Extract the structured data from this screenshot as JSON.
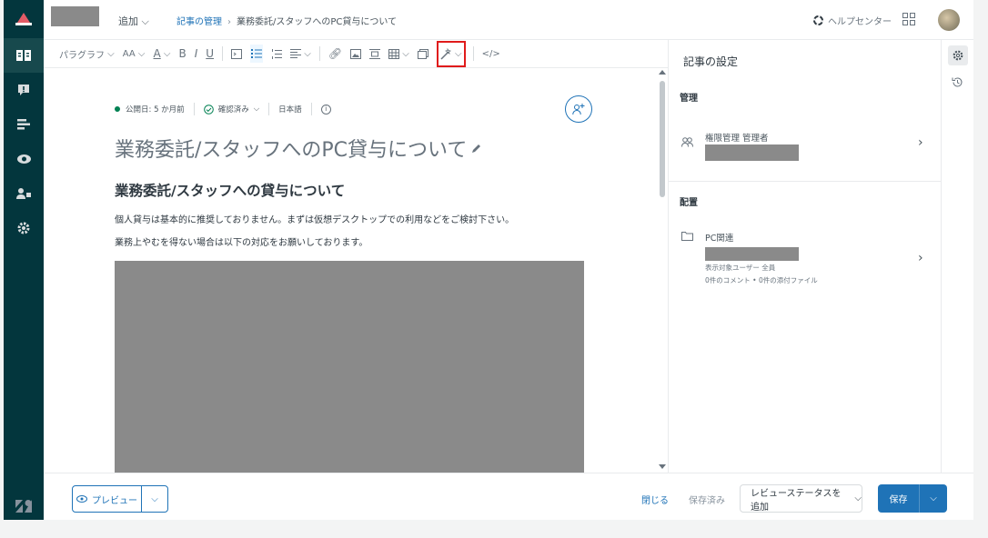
{
  "topbar": {
    "add_label": "追加",
    "breadcrumb": {
      "parent": "記事の管理",
      "current": "業務委託/スタッフへのPC貸与について"
    },
    "help_label": "ヘルプセンター"
  },
  "toolbar": {
    "paragraph_label": "パラグラフ",
    "font_size_label": "AA",
    "bold": "B",
    "italic": "I",
    "underline": "U"
  },
  "article": {
    "status_published": "公開日: 5 か月前",
    "status_verified": "確認済み",
    "language": "日本語",
    "title": "業務委託/スタッフへのPC貸与について",
    "heading": "業務委託/スタッフへの貸与について",
    "paragraph1": "個人貸与は基本的に推奨しておりません。まずは仮想デスクトップでの利用などをご検討下さい。",
    "paragraph2": "業務上やむを得ない場合は以下の対応をお願いしております。"
  },
  "settings": {
    "title": "記事の設定",
    "manage_section": "管理",
    "permission_label": "権限管理 管理者",
    "placement_section": "配置",
    "category_label": "PC関連",
    "visibility_label": "表示対象ユーザー 全員",
    "counts_label": "0件のコメント • 0件の添付ファイル"
  },
  "footer": {
    "preview_label": "プレビュー",
    "close_label": "閉じる",
    "saved_label": "保存済み",
    "review_label": "レビューステータスを追加",
    "save_label": "保存"
  },
  "colors": {
    "nav_bg": "#03363d",
    "primary": "#1f73b7",
    "highlight": "#e01b1b",
    "success": "#038153"
  }
}
